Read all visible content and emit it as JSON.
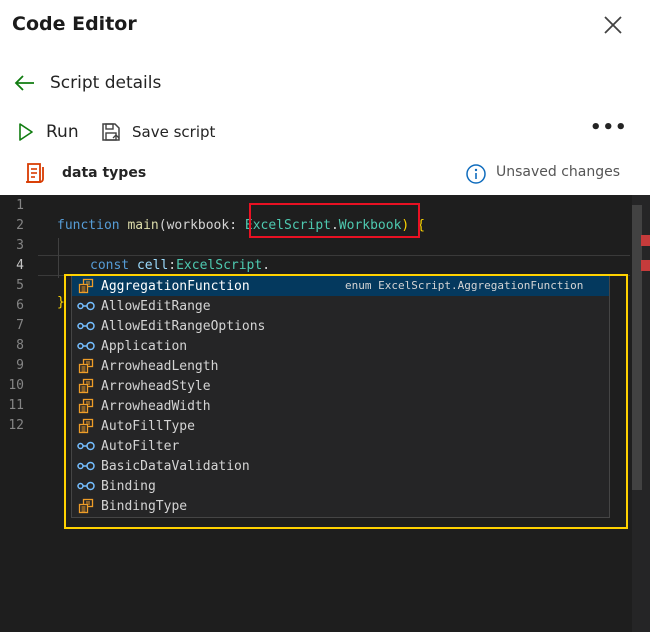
{
  "header": {
    "title": "Code Editor",
    "close_icon": "close-icon"
  },
  "nav": {
    "back_label": "Script details"
  },
  "toolbar": {
    "run_label": "Run",
    "save_label": "Save script",
    "more_label": "•••"
  },
  "script": {
    "name": "data types",
    "status": "Unsaved changes"
  },
  "colors": {
    "accent": "#107c10",
    "script_icon": "#d83b01",
    "info": "#0f6cbd",
    "highlight_red": "#e81123",
    "highlight_yellow": "#ffd200"
  },
  "editor": {
    "line_numbers": [
      "1",
      "2",
      "3",
      "4",
      "5",
      "6",
      "7",
      "8",
      "9",
      "10",
      "11",
      "12"
    ],
    "active_line": "4",
    "line2": {
      "kw": "function",
      "fn": "main",
      "open": "(",
      "param": "workbook",
      "colon": ": ",
      "type1": "ExcelScript",
      "dot": ".",
      "type2": "Workbook",
      "close": ")",
      "space": " ",
      "brace": "{"
    },
    "line4": {
      "kw": "const",
      "space": " ",
      "var": "cell",
      "colon": ":",
      "type": "ExcelScript",
      "dot": "."
    },
    "line5": {
      "brace": "}"
    }
  },
  "suggestions": {
    "items": [
      {
        "label": "AggregationFunction",
        "kind": "enum",
        "detail": "enum ExcelScript.AggregationFunction",
        "selected": true
      },
      {
        "label": "AllowEditRange",
        "kind": "interface"
      },
      {
        "label": "AllowEditRangeOptions",
        "kind": "interface"
      },
      {
        "label": "Application",
        "kind": "interface"
      },
      {
        "label": "ArrowheadLength",
        "kind": "enum"
      },
      {
        "label": "ArrowheadStyle",
        "kind": "enum"
      },
      {
        "label": "ArrowheadWidth",
        "kind": "enum"
      },
      {
        "label": "AutoFillType",
        "kind": "enum"
      },
      {
        "label": "AutoFilter",
        "kind": "interface"
      },
      {
        "label": "BasicDataValidation",
        "kind": "interface"
      },
      {
        "label": "Binding",
        "kind": "interface"
      },
      {
        "label": "BindingType",
        "kind": "enum"
      }
    ]
  }
}
